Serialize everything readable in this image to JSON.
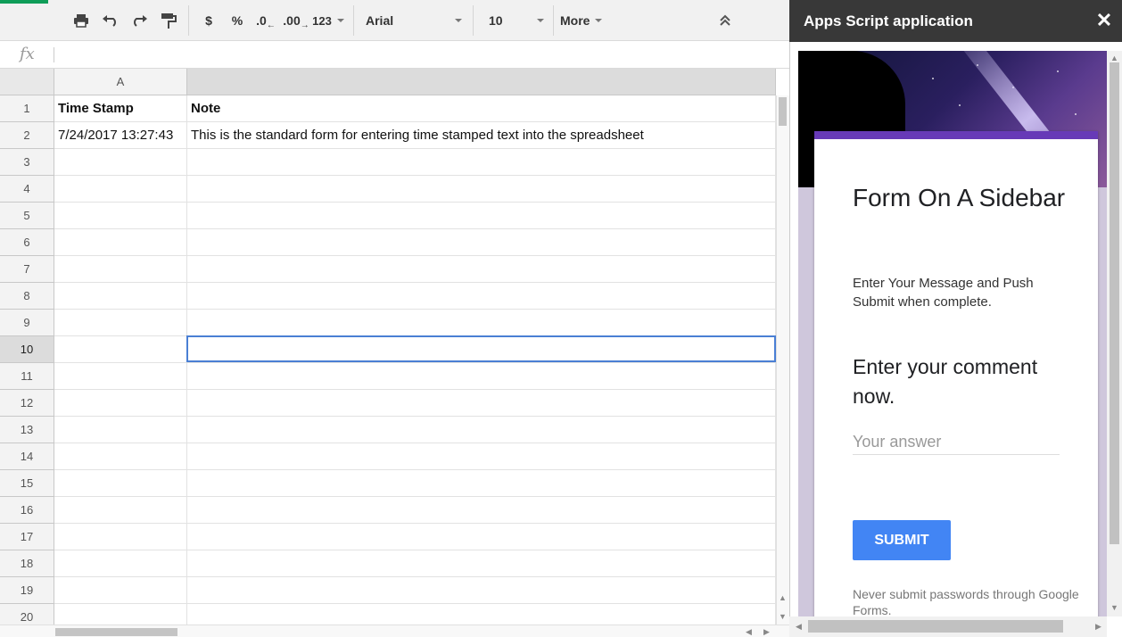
{
  "toolbar": {
    "print_icon": "print-icon",
    "undo_icon": "undo-icon",
    "redo_icon": "redo-icon",
    "paint_format_icon": "paint-format-icon",
    "currency_label": "$",
    "percent_label": "%",
    "decrease_decimal_label": ".0",
    "increase_decimal_label": ".00",
    "number_format_label": "123",
    "font_family": "Arial",
    "font_size": "10",
    "more_label": "More"
  },
  "formula_bar": {
    "fx_label": "fx",
    "value": ""
  },
  "grid": {
    "columns": [
      "A",
      ""
    ],
    "rows": [
      {
        "num": "1",
        "a": "Time Stamp",
        "b": "Note"
      },
      {
        "num": "2",
        "a": "7/24/2017 13:27:43",
        "b": "This is the standard form for entering time stamped text into the spreadsheet"
      },
      {
        "num": "3",
        "a": "",
        "b": ""
      },
      {
        "num": "4",
        "a": "",
        "b": ""
      },
      {
        "num": "5",
        "a": "",
        "b": ""
      },
      {
        "num": "6",
        "a": "",
        "b": ""
      },
      {
        "num": "7",
        "a": "",
        "b": ""
      },
      {
        "num": "8",
        "a": "",
        "b": ""
      },
      {
        "num": "9",
        "a": "",
        "b": ""
      },
      {
        "num": "10",
        "a": "",
        "b": ""
      },
      {
        "num": "11",
        "a": "",
        "b": ""
      },
      {
        "num": "12",
        "a": "",
        "b": ""
      },
      {
        "num": "13",
        "a": "",
        "b": ""
      },
      {
        "num": "14",
        "a": "",
        "b": ""
      },
      {
        "num": "15",
        "a": "",
        "b": ""
      },
      {
        "num": "16",
        "a": "",
        "b": ""
      },
      {
        "num": "17",
        "a": "",
        "b": ""
      },
      {
        "num": "18",
        "a": "",
        "b": ""
      },
      {
        "num": "19",
        "a": "",
        "b": ""
      },
      {
        "num": "20",
        "a": "",
        "b": ""
      }
    ],
    "selected_row": "10"
  },
  "sidebar": {
    "title": "Apps Script application",
    "close_icon": "close-icon",
    "form": {
      "title": "Form On A Sidebar",
      "description": "Enter Your Message and Push Submit when complete.",
      "question": "Enter your comment now.",
      "answer_placeholder": "Your answer",
      "answer_value": "",
      "submit_label": "SUBMIT",
      "disclaimer": "Never submit passwords through Google Forms."
    }
  },
  "colors": {
    "accent": "#4285f4",
    "form_theme": "#673ab7",
    "selection_border": "#4a7fd4",
    "sidebar_header": "#383838"
  }
}
